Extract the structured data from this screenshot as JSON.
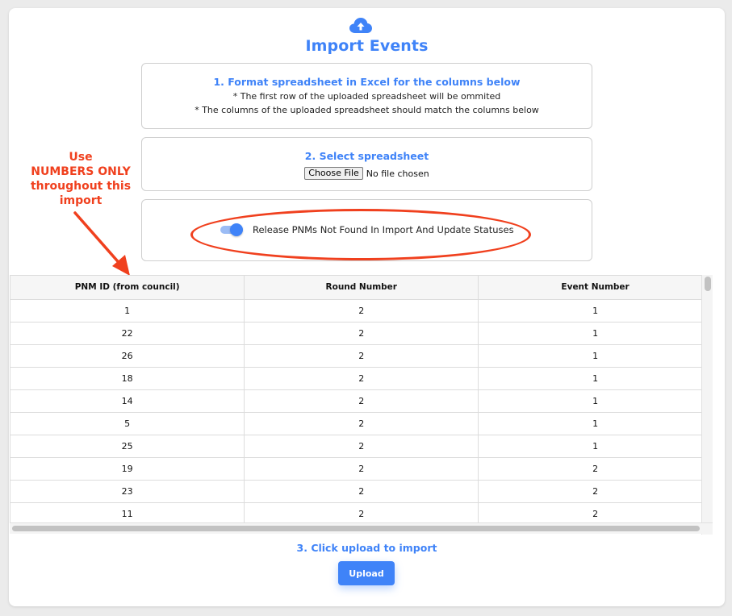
{
  "modal": {
    "title": "Import Events",
    "icon": "cloud-upload-icon",
    "accent_color": "#3f83f8"
  },
  "step1": {
    "heading": "1. Format spreadsheet in Excel for the columns below",
    "note1": "* The first row of the uploaded spreadsheet will be ommited",
    "note2": "* The columns of the uploaded spreadsheet should match the columns below"
  },
  "step2": {
    "heading": "2. Select spreadsheet",
    "choose_file_label": "Choose File",
    "file_status": "No file chosen"
  },
  "toggle": {
    "label": "Release PNMs Not Found In Import And Update Statuses",
    "checked": true
  },
  "annotation": {
    "line1": "Use",
    "line2": "NUMBERS ONLY",
    "line3": "throughout this",
    "line4": "import",
    "color": "#f0401e"
  },
  "table": {
    "headers": [
      "PNM ID (from council)",
      "Round Number",
      "Event Number"
    ],
    "rows": [
      [
        "1",
        "2",
        "1"
      ],
      [
        "22",
        "2",
        "1"
      ],
      [
        "26",
        "2",
        "1"
      ],
      [
        "18",
        "2",
        "1"
      ],
      [
        "14",
        "2",
        "1"
      ],
      [
        "5",
        "2",
        "1"
      ],
      [
        "25",
        "2",
        "1"
      ],
      [
        "19",
        "2",
        "2"
      ],
      [
        "23",
        "2",
        "2"
      ],
      [
        "11",
        "2",
        "2"
      ]
    ]
  },
  "step3": {
    "heading": "3. Click upload to import",
    "upload_label": "Upload"
  }
}
